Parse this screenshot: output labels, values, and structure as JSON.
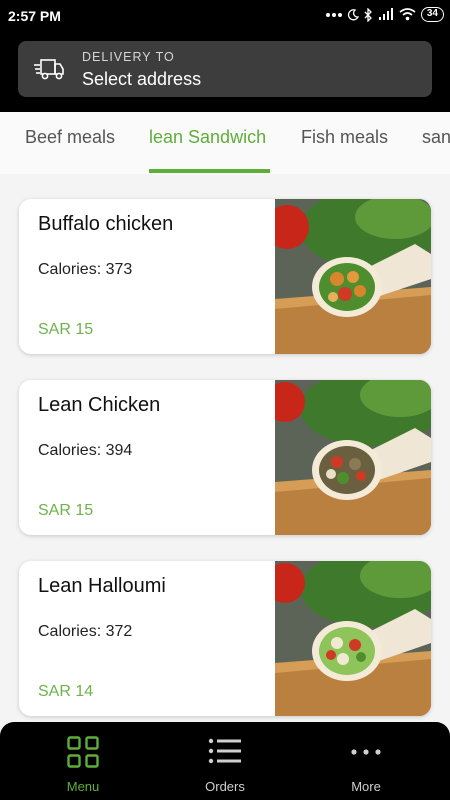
{
  "status_bar": {
    "time": "2:57 PM",
    "battery": "34"
  },
  "delivery": {
    "label": "DELIVERY TO",
    "address": "Select address"
  },
  "tabs": [
    "Beef meals",
    "lean Sandwich",
    "Fish meals",
    "sandwiches"
  ],
  "active_tab": "lean Sandwich",
  "meals": [
    {
      "name": "Buffalo chicken",
      "calories": "Calories: 373",
      "price": "SAR 15",
      "image": "buffalo-chicken-wrap"
    },
    {
      "name": "Lean Chicken",
      "calories": "Calories: 394",
      "price": "SAR 15",
      "image": "lean-chicken-wrap"
    },
    {
      "name": "Lean Halloumi",
      "calories": "Calories: 372",
      "price": "SAR 14",
      "image": "lean-halloumi-wrap"
    }
  ],
  "nav": [
    {
      "label": "Menu",
      "icon": "grid-icon",
      "active": true
    },
    {
      "label": "Orders",
      "icon": "list-icon",
      "active": false
    },
    {
      "label": "More",
      "icon": "more-dots-icon",
      "active": false
    }
  ],
  "colors": {
    "accent": "#5fae3a",
    "price": "#6db44a",
    "header": "#000000"
  }
}
